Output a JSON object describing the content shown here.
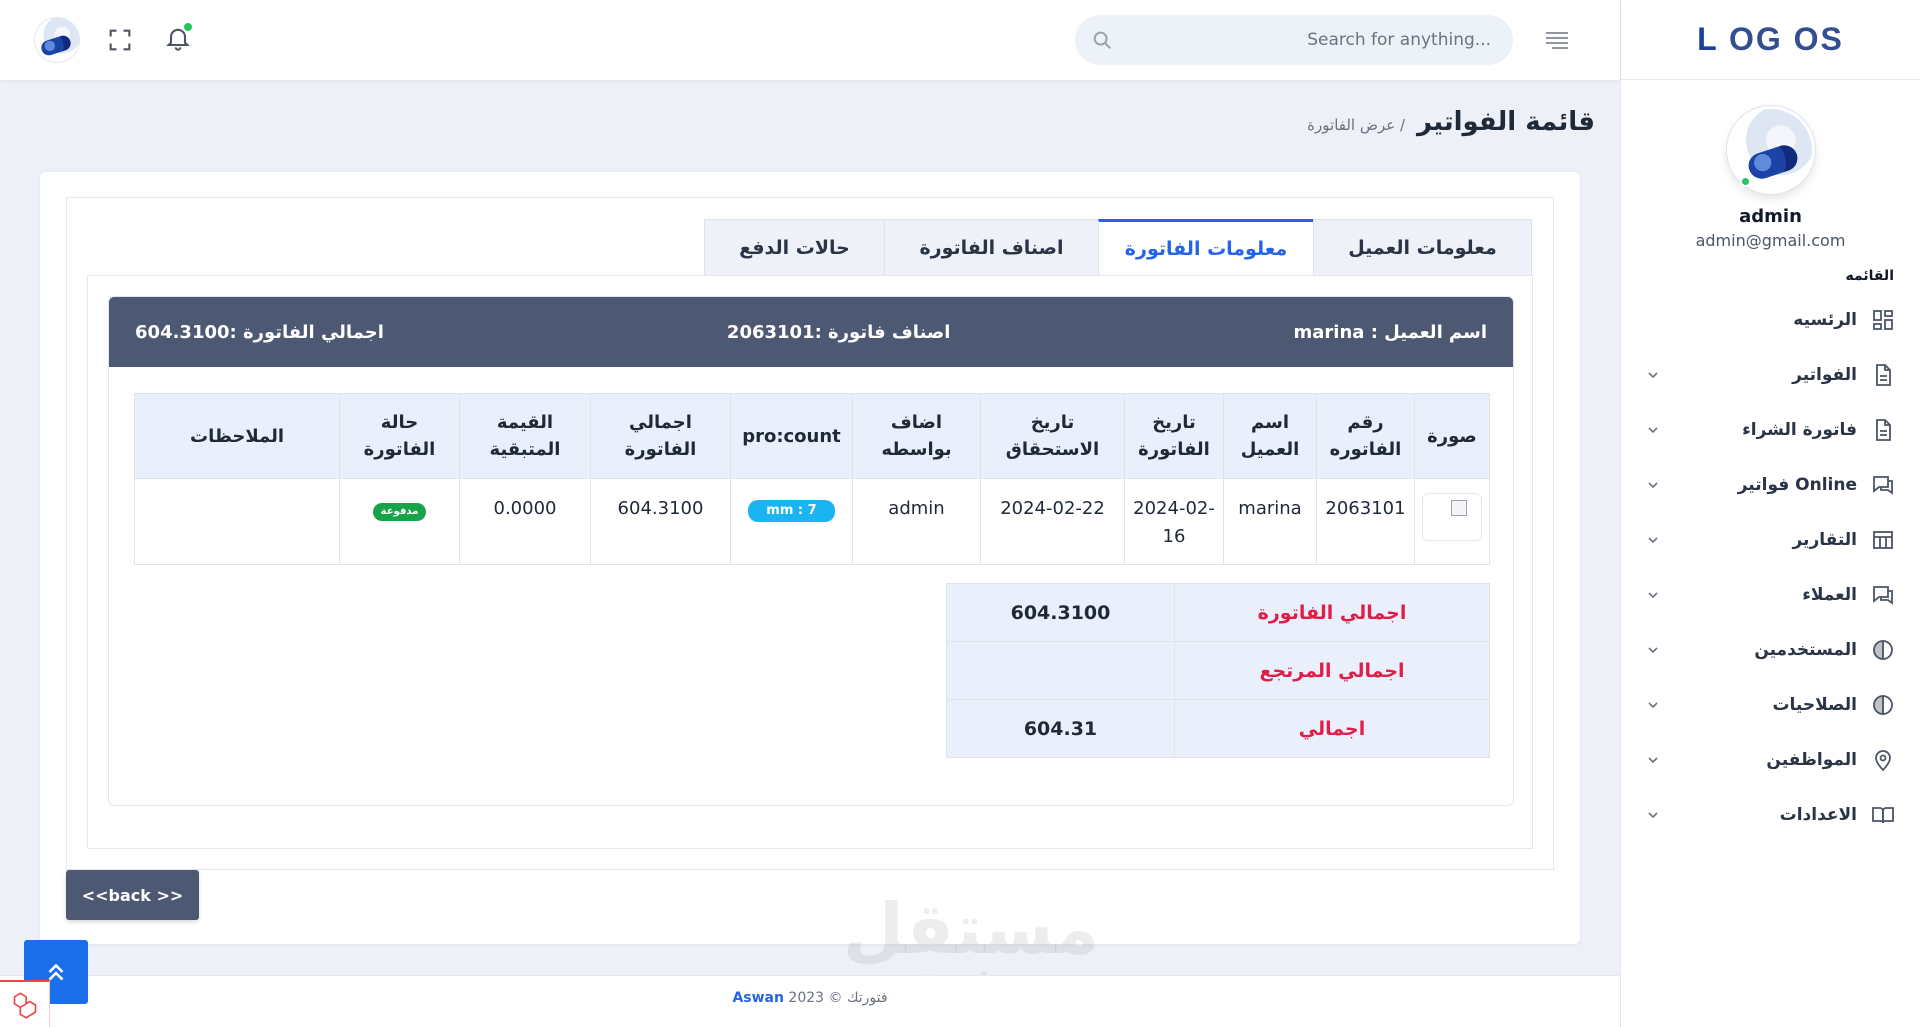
{
  "brand": {
    "logo_l": "L",
    "logo_rest": "OG OS"
  },
  "header": {
    "search_placeholder": "Search for anything..."
  },
  "sidebar": {
    "profile_name": "admin",
    "profile_email": "admin@gmail.com",
    "menu_heading": "القائمه",
    "items": [
      {
        "label": "الرئسيه",
        "icon": "dashboard-icon",
        "has_children": false
      },
      {
        "label": "الفواتير",
        "icon": "document-icon",
        "has_children": true
      },
      {
        "label": "فاتورة الشراء",
        "icon": "document-icon",
        "has_children": true
      },
      {
        "label": "فواتير Online",
        "icon": "chat-icon",
        "has_children": true
      },
      {
        "label": "التقارير",
        "icon": "table-icon",
        "has_children": true
      },
      {
        "label": "العملاء",
        "icon": "chat-icon",
        "has_children": true
      },
      {
        "label": "المستخدمين",
        "icon": "half-circle-icon",
        "has_children": true
      },
      {
        "label": "الصلاحيات",
        "icon": "half-circle-icon",
        "has_children": true
      },
      {
        "label": "المواظفين",
        "icon": "location-pin-icon",
        "has_children": true
      },
      {
        "label": "الاعدادات",
        "icon": "book-icon",
        "has_children": true
      }
    ]
  },
  "page": {
    "title": "قائمة الفواتير",
    "breadcrumb": "/ عرض الفاتورة"
  },
  "tabs": [
    {
      "label": "معلومات العميل",
      "active": false
    },
    {
      "label": "معلومات الفاتورة",
      "active": true
    },
    {
      "label": "اصناف الفاتورة",
      "active": false
    },
    {
      "label": "حالات الدفع",
      "active": false
    }
  ],
  "banner": {
    "customer": "اسم العميل : marina",
    "items": "اصناف فاتورة :2063101",
    "total": "اجمالي الفاتورة :604.3100"
  },
  "invoice_table": {
    "headers": [
      "صورة",
      "رقم الفاتوره",
      "اسم العميل",
      "تاريخ الفاتورة",
      "تاريخ الاستحقاق",
      "اضاف بواسطه",
      "pro:count",
      "اجمالي الفاتورة",
      "القيمة المتبقية",
      "حالة الفاتورة",
      "الملاحظات"
    ],
    "row": {
      "invoice_number": "2063101",
      "customer": "marina",
      "invoice_date": "2024-02-16",
      "due_date": "2024-02-22",
      "added_by": "admin",
      "count": "mm : 7",
      "total": "604.3100",
      "remaining": "0.0000",
      "status": "مدفوعة",
      "notes": ""
    }
  },
  "totals": [
    {
      "label": "اجمالي الفاتورة",
      "value": "604.3100"
    },
    {
      "label": "اجمالي المرتجع",
      "value": ""
    },
    {
      "label": "اجمالي",
      "value": "604.31"
    }
  ],
  "back_button": "<<back >>",
  "footer": {
    "prefix": "فتورتك © 2023",
    "link": "Aswan"
  },
  "watermark": {
    "arabic": "مستقل",
    "latin": "mostaql.com"
  },
  "colors": {
    "accent": "#2563eb",
    "banner": "#4d5873",
    "danger": "#e11d48",
    "success": "#16a34a",
    "count_pill": "#1ab5f0"
  }
}
